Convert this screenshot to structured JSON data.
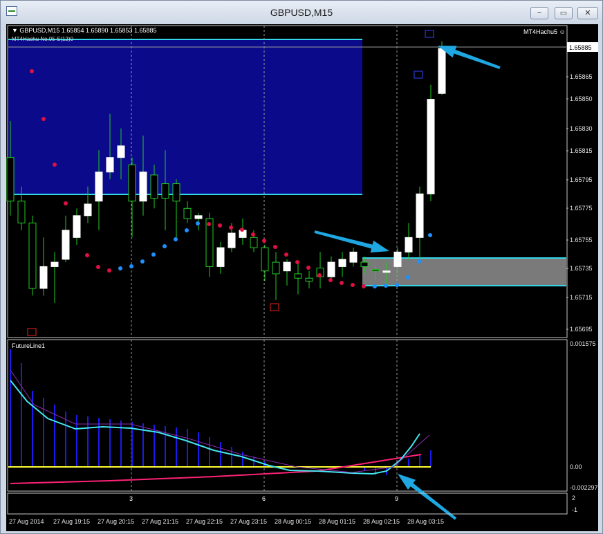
{
  "window": {
    "title": "GBPUSD,M15",
    "buttons": {
      "minimize": "−",
      "maximize": "▭",
      "close": "✕"
    }
  },
  "main_panel": {
    "header": "GBPUSD,M15  1.65854 1.65890 1.65853 1.65885",
    "indicator_label": "MT4Hachu  No.05  S(12)0",
    "expert_label": "MT4Hachu5 ☺",
    "price_ticks": [
      "1.65865",
      "1.65850",
      "1.65830",
      "1.65815",
      "1.65795",
      "1.65775",
      "1.65755",
      "1.65735",
      "1.65715",
      "1.65695"
    ],
    "current_price": "1.65885"
  },
  "sub_panel": {
    "label": "FutureLine1",
    "ticks": [
      "0.001575",
      "0.00",
      "-0.002297"
    ]
  },
  "bottom_panel": {
    "bar_numbers": [
      "3",
      "6",
      "9"
    ],
    "axis_ticks": [
      "2",
      "-1"
    ]
  },
  "time_axis": [
    "27 Aug 2014",
    "27 Aug 19:15",
    "27 Aug 20:15",
    "27 Aug 21:15",
    "27 Aug 22:15",
    "27 Aug 23:15",
    "28 Aug 00:15",
    "28 Aug 01:15",
    "28 Aug 02:15",
    "28 Aug 03:15"
  ],
  "colors": {
    "background": "#000000",
    "zone_blue": "#0a0a8a",
    "zone_gray": "#7a7a7a",
    "zone_border": "#33d6e6",
    "bull_candle": "#ffffff",
    "wick": "#22cc22",
    "dot_red": "#dd1144",
    "dot_blue": "#1e90ff",
    "arrow": "#1ea7e0",
    "future_cyan": "#44e6f0",
    "future_pink": "#ff2277",
    "future_yellow": "#ffff33",
    "histogram": "#1a1aee"
  },
  "chart_data": {
    "type": "candlestick",
    "symbol": "GBPUSD",
    "timeframe": "M15",
    "ohlc": [
      {
        "o": 1.6581,
        "h": 1.65835,
        "l": 1.6577,
        "c": 1.6578
      },
      {
        "o": 1.6578,
        "h": 1.6579,
        "l": 1.6576,
        "c": 1.65765
      },
      {
        "o": 1.65765,
        "h": 1.6577,
        "l": 1.65715,
        "c": 1.6572
      },
      {
        "o": 1.6572,
        "h": 1.65755,
        "l": 1.65715,
        "c": 1.65735
      },
      {
        "o": 1.65735,
        "h": 1.65745,
        "l": 1.6571,
        "c": 1.65738
      },
      {
        "o": 1.6574,
        "h": 1.6577,
        "l": 1.65738,
        "c": 1.6576
      },
      {
        "o": 1.65755,
        "h": 1.65775,
        "l": 1.6575,
        "c": 1.6577
      },
      {
        "o": 1.6577,
        "h": 1.6579,
        "l": 1.65765,
        "c": 1.65778
      },
      {
        "o": 1.6578,
        "h": 1.65815,
        "l": 1.6576,
        "c": 1.658
      },
      {
        "o": 1.658,
        "h": 1.6584,
        "l": 1.65795,
        "c": 1.6581
      },
      {
        "o": 1.6581,
        "h": 1.6583,
        "l": 1.65795,
        "c": 1.65818
      },
      {
        "o": 1.65805,
        "h": 1.6581,
        "l": 1.65755,
        "c": 1.6578
      },
      {
        "o": 1.6578,
        "h": 1.65825,
        "l": 1.6577,
        "c": 1.658
      },
      {
        "o": 1.65798,
        "h": 1.65805,
        "l": 1.65775,
        "c": 1.65782
      },
      {
        "o": 1.65792,
        "h": 1.65815,
        "l": 1.6576,
        "c": 1.65782
      },
      {
        "o": 1.65792,
        "h": 1.65795,
        "l": 1.65755,
        "c": 1.6578
      },
      {
        "o": 1.65775,
        "h": 1.6578,
        "l": 1.65765,
        "c": 1.65768
      },
      {
        "o": 1.65768,
        "h": 1.65772,
        "l": 1.6576,
        "c": 1.6577
      },
      {
        "o": 1.65768,
        "h": 1.65772,
        "l": 1.65728,
        "c": 1.65735
      },
      {
        "o": 1.65735,
        "h": 1.65752,
        "l": 1.6573,
        "c": 1.65748
      },
      {
        "o": 1.65748,
        "h": 1.65765,
        "l": 1.65745,
        "c": 1.65758
      },
      {
        "o": 1.65755,
        "h": 1.65768,
        "l": 1.6575,
        "c": 1.6576
      },
      {
        "o": 1.65755,
        "h": 1.6576,
        "l": 1.65745,
        "c": 1.65748
      },
      {
        "o": 1.65748,
        "h": 1.6575,
        "l": 1.65725,
        "c": 1.65732
      },
      {
        "o": 1.65738,
        "h": 1.65745,
        "l": 1.65712,
        "c": 1.6573
      },
      {
        "o": 1.65732,
        "h": 1.6574,
        "l": 1.65722,
        "c": 1.65738
      },
      {
        "o": 1.6573,
        "h": 1.65738,
        "l": 1.65716,
        "c": 1.65727
      },
      {
        "o": 1.65727,
        "h": 1.65732,
        "l": 1.6572,
        "c": 1.65725
      },
      {
        "o": 1.65734,
        "h": 1.65745,
        "l": 1.6572,
        "c": 1.65728
      },
      {
        "o": 1.65728,
        "h": 1.65742,
        "l": 1.65725,
        "c": 1.65738
      },
      {
        "o": 1.65735,
        "h": 1.65745,
        "l": 1.65728,
        "c": 1.6574
      },
      {
        "o": 1.65738,
        "h": 1.65748,
        "l": 1.65735,
        "c": 1.65745
      },
      {
        "o": 1.65738,
        "h": 1.65742,
        "l": 1.6573,
        "c": 1.65735
      },
      {
        "o": 1.65733,
        "h": 1.65736,
        "l": 1.65726,
        "c": 1.65732
      },
      {
        "o": 1.65732,
        "h": 1.65738,
        "l": 1.65722,
        "c": 1.65732
      },
      {
        "o": 1.65735,
        "h": 1.65748,
        "l": 1.65728,
        "c": 1.65745
      },
      {
        "o": 1.65745,
        "h": 1.65765,
        "l": 1.6574,
        "c": 1.65755
      },
      {
        "o": 1.65755,
        "h": 1.6579,
        "l": 1.6574,
        "c": 1.65785
      },
      {
        "o": 1.65785,
        "h": 1.6586,
        "l": 1.6578,
        "c": 1.6585
      },
      {
        "o": 1.65854,
        "h": 1.6589,
        "l": 1.65853,
        "c": 1.65885
      }
    ],
    "price_axis": {
      "min": 1.6569,
      "max": 1.65895
    },
    "zones": [
      {
        "name": "resistance",
        "from": 1.6579,
        "to": 1.65895
      },
      {
        "name": "support",
        "from": 1.65725,
        "to": 1.65745
      }
    ]
  }
}
